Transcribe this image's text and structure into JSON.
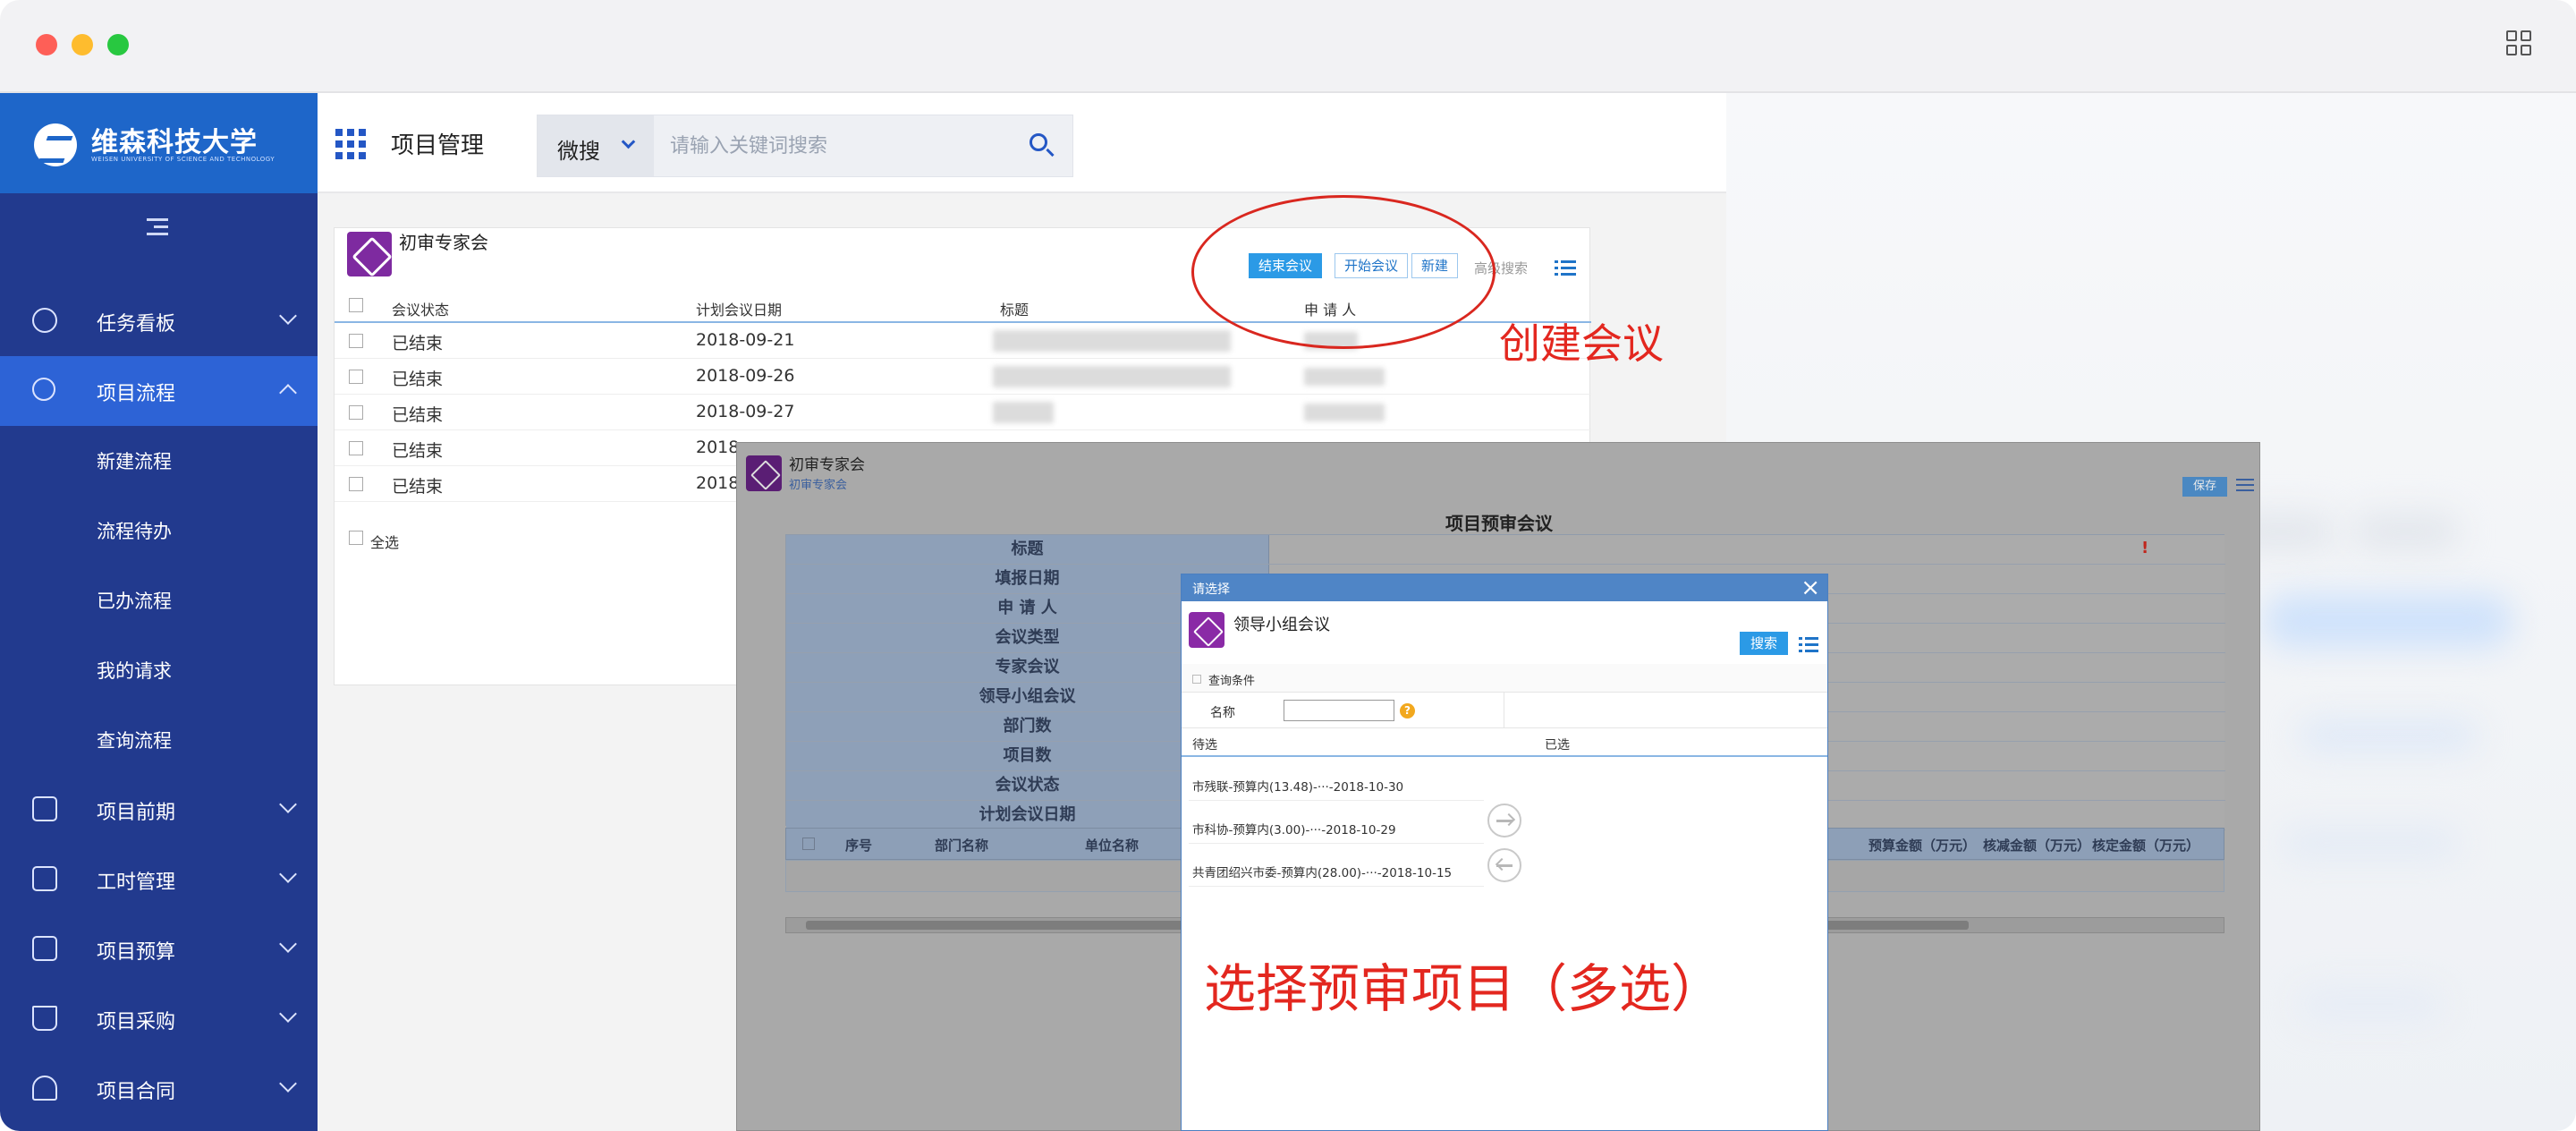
{
  "window": {
    "traffic_lights": [
      "#fe5f57",
      "#febc2e",
      "#28c840"
    ],
    "grid_icon": "grid-icon"
  },
  "sidebar": {
    "brand": {
      "title": "维森科技大学",
      "subtitle": "WEISEN UNIVERSITY OF SCIENCE AND TECHNOLOGY"
    },
    "collapse_icon": "collapse-icon",
    "items": [
      {
        "label": "任务看板",
        "icon": "dashboard-icon",
        "expanded": false
      },
      {
        "label": "项目流程",
        "icon": "flow-icon",
        "expanded": true,
        "active": true
      },
      {
        "label": "项目前期",
        "icon": "document-icon",
        "expanded": false
      },
      {
        "label": "工时管理",
        "icon": "list-icon",
        "expanded": false
      },
      {
        "label": "项目预算",
        "icon": "budget-icon",
        "expanded": false
      },
      {
        "label": "项目采购",
        "icon": "cart-icon",
        "expanded": false
      },
      {
        "label": "项目合同",
        "icon": "stamp-icon",
        "expanded": false
      }
    ],
    "subitems": [
      "新建流程",
      "流程待办",
      "已办流程",
      "我的请求",
      "查询流程"
    ],
    "colors": {
      "sidebar": "#223a8e",
      "logo_bar": "#1e66c9",
      "active": "#2d63d6"
    }
  },
  "header": {
    "title": "项目管理",
    "search": {
      "scope": "微搜",
      "placeholder": "请输入关键词搜索"
    }
  },
  "meeting_list": {
    "title": "初审专家会",
    "buttons": {
      "end": "结束会议",
      "start": "开始会议",
      "new": "新建",
      "advanced": "高级搜索"
    },
    "columns": [
      "会议状态",
      "计划会议日期",
      "标题",
      "申 请 人"
    ],
    "rows": [
      {
        "status": "已结束",
        "date": "2018-09-21"
      },
      {
        "status": "已结束",
        "date": "2018-09-26"
      },
      {
        "status": "已结束",
        "date": "2018-09-27"
      },
      {
        "status": "已结束",
        "date": "2018"
      },
      {
        "status": "已结束",
        "date": "2018"
      }
    ],
    "select_all": "全选"
  },
  "meeting_form": {
    "title": "初审专家会",
    "subtitle": "初审专家会",
    "save": "保存",
    "heading": "项目预审会议",
    "fields": [
      "标题",
      "填报日期",
      "申 请 人",
      "会议类型",
      "专家会议",
      "领导小组会议",
      "部门数",
      "项目数",
      "会议状态",
      "计划会议日期"
    ],
    "grid_headers": {
      "seq": "序号",
      "dept": "部门名称",
      "unit": "单位名称",
      "budget": "预算金额（万元）",
      "cut": "核减金额（万元）",
      "approved": "核定金额（万元）"
    }
  },
  "dialog": {
    "bar_title": "请选择",
    "title": "领导小组会议",
    "search_button": "搜索",
    "section": "查询条件",
    "name_label": "名称",
    "pending_label": "待选",
    "selected_label": "已选",
    "candidates": [
      "市残联-预算内(13.48)-···-2018-10-30",
      "市科协-预算内(3.00)-···-2018-10-29",
      "共青团绍兴市委-预算内(28.00)-···-2018-10-15"
    ]
  },
  "annotations": {
    "create_meeting": "创建会议",
    "select_items": "选择预审项目（多选）",
    "color": "#e3271f"
  }
}
